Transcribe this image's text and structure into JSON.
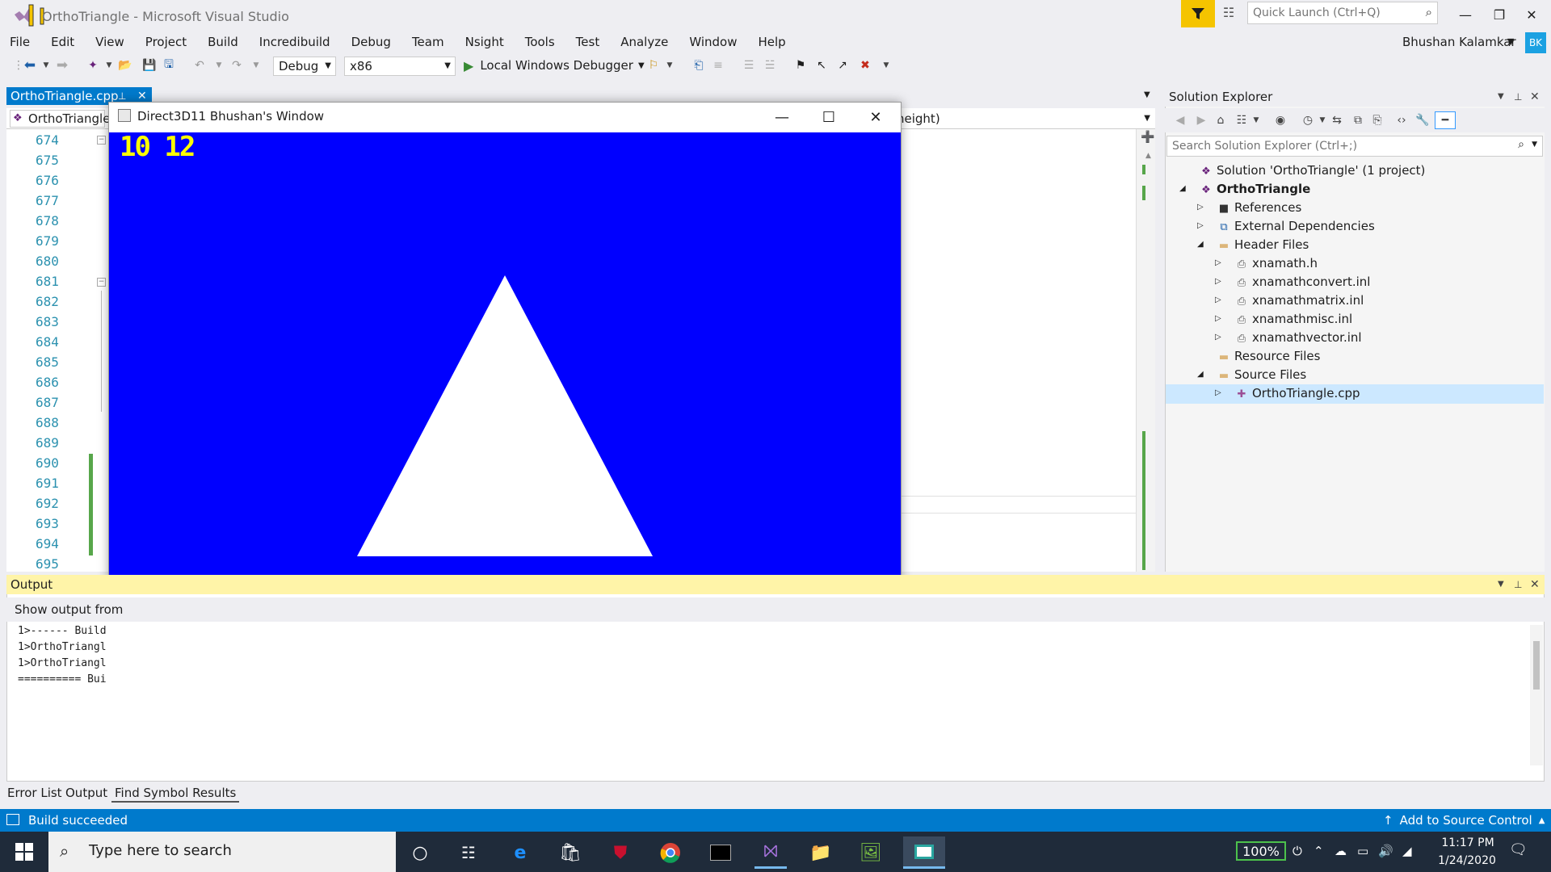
{
  "window": {
    "title": "OrthoTriangle - Microsoft Visual Studio",
    "quick_launch_placeholder": "Quick Launch (Ctrl+Q)",
    "user_name": "Bhushan Kalamkar",
    "user_initials": "BK"
  },
  "menu": [
    "File",
    "Edit",
    "View",
    "Project",
    "Build",
    "Incredibuild",
    "Debug",
    "Team",
    "Nsight",
    "Tools",
    "Test",
    "Analyze",
    "Window",
    "Help"
  ],
  "toolbar": {
    "config": "Debug",
    "platform": "x86",
    "run_label": "Local Windows Debugger"
  },
  "editor": {
    "tab_label": "OrthoTriangle.cpp",
    "nav_left": "OrthoTriangle",
    "nav_right": "height)",
    "line_numbers": [
      "674",
      "675",
      "676",
      "677",
      "678",
      "679",
      "680",
      "681",
      "682",
      "683",
      "684",
      "685",
      "686",
      "687",
      "688",
      "689",
      "690",
      "691",
      "692",
      "693",
      "694",
      "695"
    ]
  },
  "dx_window": {
    "title": "Direct3D11 Bhushan's Window",
    "fps_text": "10 12",
    "background": "#0000ff",
    "shape_color": "#ffffff"
  },
  "solution_explorer": {
    "title": "Solution Explorer",
    "search_placeholder": "Search Solution Explorer (Ctrl+;)",
    "items": [
      {
        "label": "Solution 'OrthoTriangle' (1 project)",
        "icon": "solution-icon",
        "level": 0,
        "arrow": ""
      },
      {
        "label": "OrthoTriangle",
        "icon": "project-icon",
        "level": 0,
        "arrow": "expanded",
        "bold": true
      },
      {
        "label": "References",
        "icon": "references-icon",
        "level": 1,
        "arrow": "collapsed"
      },
      {
        "label": "External Dependencies",
        "icon": "external-deps-icon",
        "level": 1,
        "arrow": "collapsed"
      },
      {
        "label": "Header Files",
        "icon": "folder-icon",
        "level": 1,
        "arrow": "expanded"
      },
      {
        "label": "xnamath.h",
        "icon": "file-icon",
        "level": 2,
        "arrow": "collapsed"
      },
      {
        "label": "xnamathconvert.inl",
        "icon": "file-icon",
        "level": 2,
        "arrow": "collapsed"
      },
      {
        "label": "xnamathmatrix.inl",
        "icon": "file-icon",
        "level": 2,
        "arrow": "collapsed"
      },
      {
        "label": "xnamathmisc.inl",
        "icon": "file-icon",
        "level": 2,
        "arrow": "collapsed"
      },
      {
        "label": "xnamathvector.inl",
        "icon": "file-icon",
        "level": 2,
        "arrow": "collapsed"
      },
      {
        "label": "Resource Files",
        "icon": "folder-icon",
        "level": 1,
        "arrow": ""
      },
      {
        "label": "Source Files",
        "icon": "folder-icon",
        "level": 1,
        "arrow": "expanded"
      },
      {
        "label": "OrthoTriangle.cpp",
        "icon": "cpp-file-icon",
        "level": 2,
        "arrow": "collapsed",
        "selected": true
      }
    ]
  },
  "output": {
    "title": "Output",
    "show_from": "Show output from",
    "lines": [
      "1>------ Build",
      "1>OrthoTriangl",
      "1>OrthoTriangl",
      "========== Bui"
    ]
  },
  "bottom_tabs": [
    "Error List",
    "Output",
    "Find Symbol Results"
  ],
  "status": {
    "text": "Build succeeded",
    "source_control": "Add to Source Control"
  },
  "taskbar": {
    "search_placeholder": "Type here to search",
    "battery": "100%",
    "time": "11:17 PM",
    "date": "1/24/2020"
  }
}
